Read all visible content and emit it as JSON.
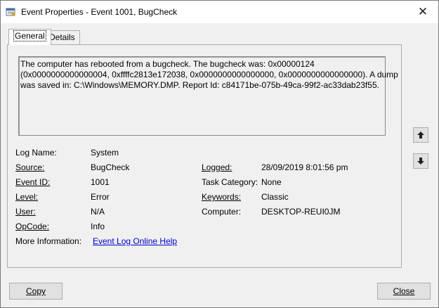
{
  "window": {
    "title": "Event Properties - Event 1001, BugCheck"
  },
  "tabs": [
    {
      "label": "General",
      "active": true
    },
    {
      "label": "Details",
      "active": false
    }
  ],
  "description": {
    "lines": [
      "The computer has rebooted from a bugcheck.  The bugcheck was: 0x00000124",
      "(0x0000000000000004, 0xffffc2813e172038, 0x0000000000000000, 0x0000000000000000). A dump",
      "was saved in: C:\\Windows\\MEMORY.DMP. Report Id: c84171be-075b-49ca-99f2-ac33dab23f55."
    ]
  },
  "fields": {
    "log_name": {
      "label": "Log Name:",
      "value": "System"
    },
    "source": {
      "label": "Source:",
      "value": "BugCheck"
    },
    "logged": {
      "label": "Logged:",
      "value": "28/09/2019 8:01:56 pm"
    },
    "event_id": {
      "label": "Event ID:",
      "value": "1001"
    },
    "task_category": {
      "label": "Task Category:",
      "value": "None"
    },
    "level": {
      "label": "Level:",
      "value": "Error"
    },
    "keywords": {
      "label": "Keywords:",
      "value": "Classic"
    },
    "user": {
      "label": "User:",
      "value": "N/A"
    },
    "computer": {
      "label": "Computer:",
      "value": "DESKTOP-REUI0JM"
    },
    "opcode": {
      "label": "OpCode:",
      "value": "Info"
    },
    "more_info": {
      "label": "More Information:",
      "link": "Event Log Online Help"
    }
  },
  "buttons": {
    "copy": "Copy",
    "close": "Close"
  },
  "colors": {
    "background": "#f0f0f0",
    "link": "#0000cc",
    "button": "#e1e1e1"
  },
  "icons": {
    "app": "event-viewer-icon",
    "up": "arrow-up-icon",
    "down": "arrow-down-icon",
    "close": "close-icon"
  }
}
